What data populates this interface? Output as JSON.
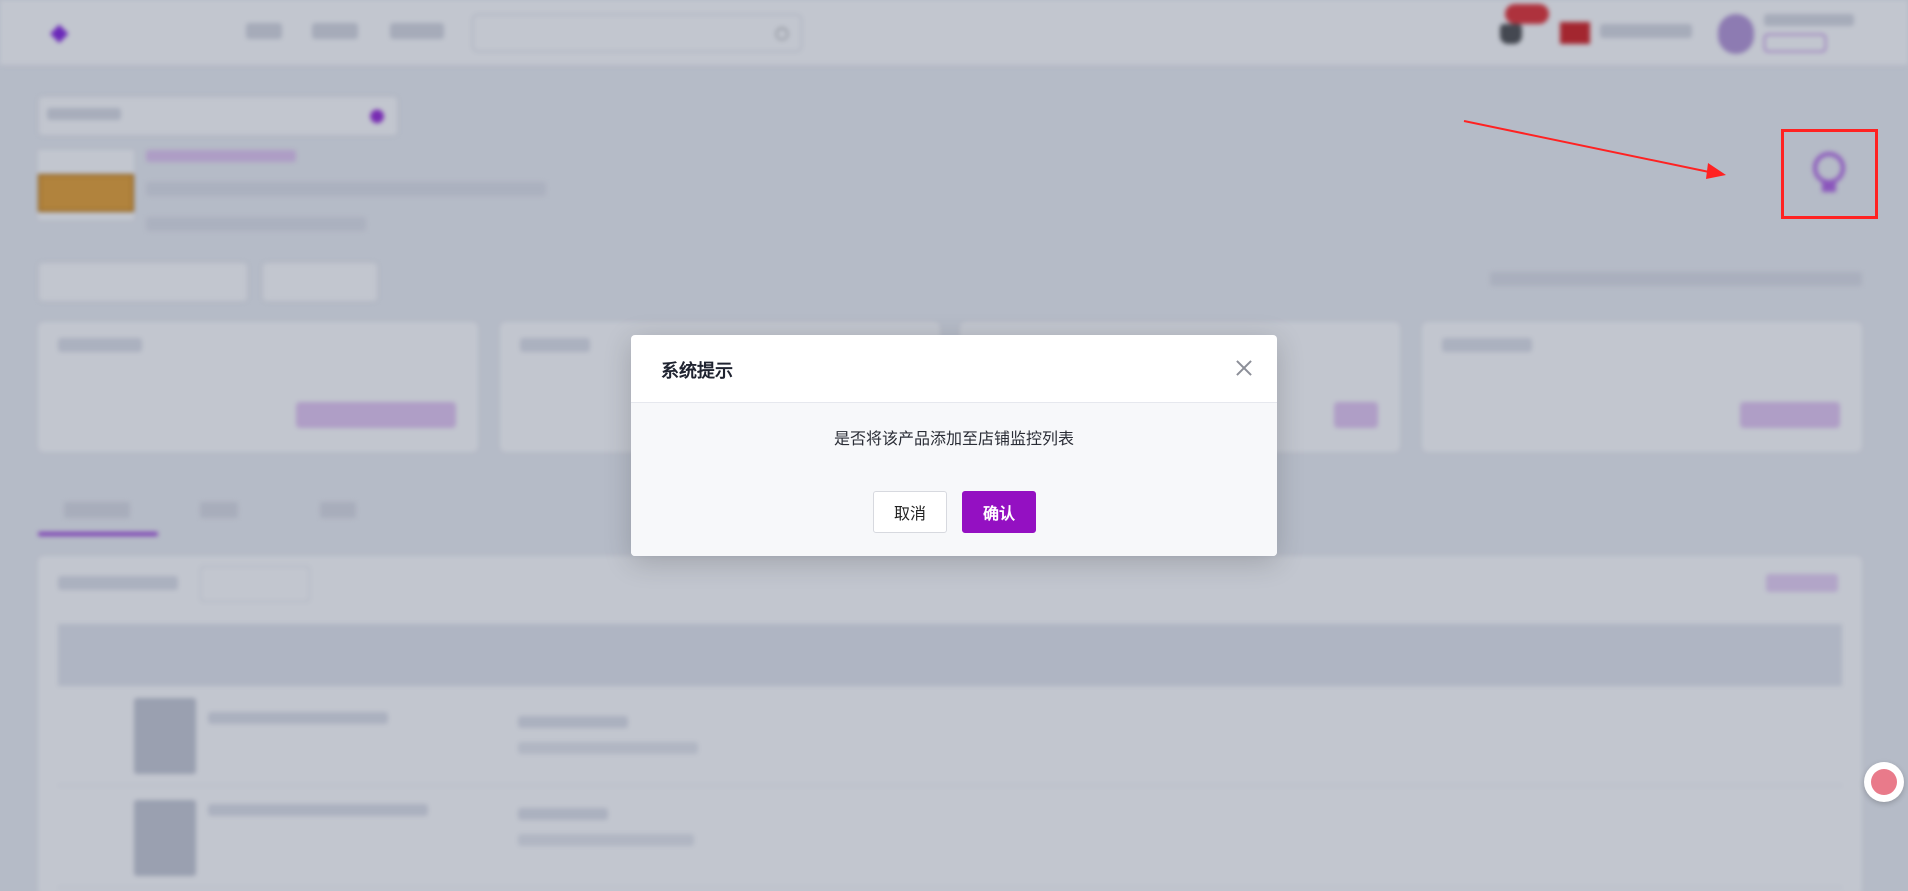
{
  "dialog": {
    "title": "系统提示",
    "message": "是否将该产品添加至店铺监控列表",
    "cancel_label": "取消",
    "confirm_label": "确认"
  },
  "colors": {
    "accent": "#9410c2",
    "annotation": "#ff2222"
  },
  "icons": {
    "close": "close-icon",
    "monitor": "location-pin-icon",
    "translate": "translate-icon"
  }
}
